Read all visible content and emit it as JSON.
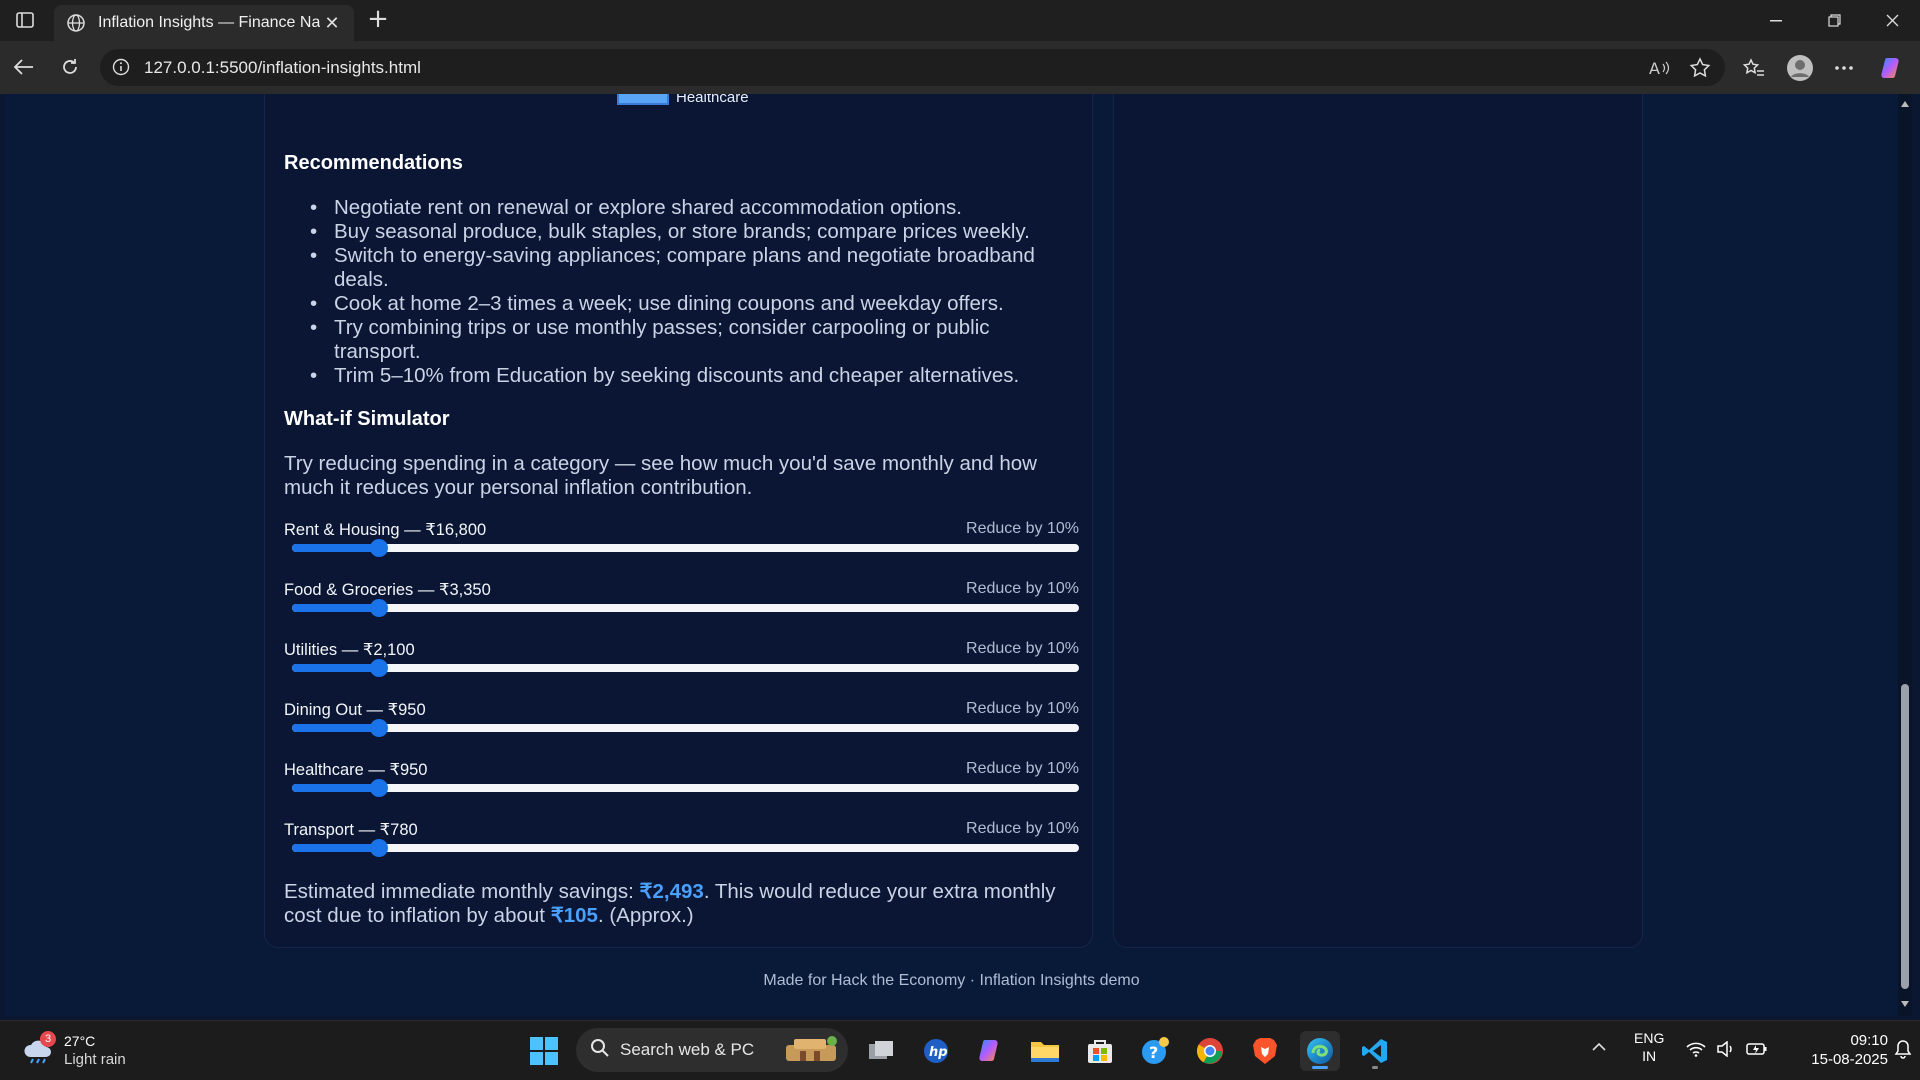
{
  "browser": {
    "tab_title": "Inflation Insights — Finance Navigator",
    "url": "127.0.0.1:5500/inflation-insights.html"
  },
  "legend": {
    "visible_label": "Healthcare"
  },
  "recommendations": {
    "heading": "Recommendations",
    "items": [
      "Negotiate rent on renewal or explore shared accommodation options.",
      "Buy seasonal produce, bulk staples, or store brands; compare prices weekly.",
      "Switch to energy-saving appliances; compare plans and negotiate broadband deals.",
      "Cook at home 2–3 times a week; use dining coupons and weekday offers.",
      "Try combining trips or use monthly passes; consider carpooling or public transport.",
      "Trim 5–10% from Education by seeking discounts and cheaper alternatives."
    ]
  },
  "simulator": {
    "heading": "What-if Simulator",
    "intro": "Try reducing spending in a category — see how much you'd save monthly and how much it reduces your personal inflation contribution.",
    "sliders": [
      {
        "label": "Rent & Housing — ₹16,800",
        "reduce": "Reduce by 10%",
        "value": 10,
        "max": 100
      },
      {
        "label": "Food & Groceries — ₹3,350",
        "reduce": "Reduce by 10%",
        "value": 10,
        "max": 100
      },
      {
        "label": "Utilities — ₹2,100",
        "reduce": "Reduce by 10%",
        "value": 10,
        "max": 100
      },
      {
        "label": "Dining Out — ₹950",
        "reduce": "Reduce by 10%",
        "value": 10,
        "max": 100
      },
      {
        "label": "Healthcare — ₹950",
        "reduce": "Reduce by 10%",
        "value": 10,
        "max": 100
      },
      {
        "label": "Transport — ₹780",
        "reduce": "Reduce by 10%",
        "value": 10,
        "max": 100
      }
    ],
    "savings_prefix": "Estimated immediate monthly savings: ",
    "savings_value": "₹2,493",
    "savings_middle": ". This would reduce your extra monthly cost due to inflation by about ",
    "inflation_value": "₹105",
    "savings_suffix": ". (Approx.)"
  },
  "footer": "Made for Hack the Economy · Inflation Insights demo",
  "taskbar": {
    "weather_temp": "27°C",
    "weather_cond": "Light rain",
    "weather_badge": "3",
    "search_placeholder": "Search web & PC",
    "lang": "ENG",
    "region": "IN",
    "time": "09:10",
    "date": "15-08-2025"
  },
  "colors": {
    "accent": "#1a73e8",
    "highlight": "#4aa0ff",
    "page_bg": "#091a38",
    "card_bg": "#0a1633"
  }
}
